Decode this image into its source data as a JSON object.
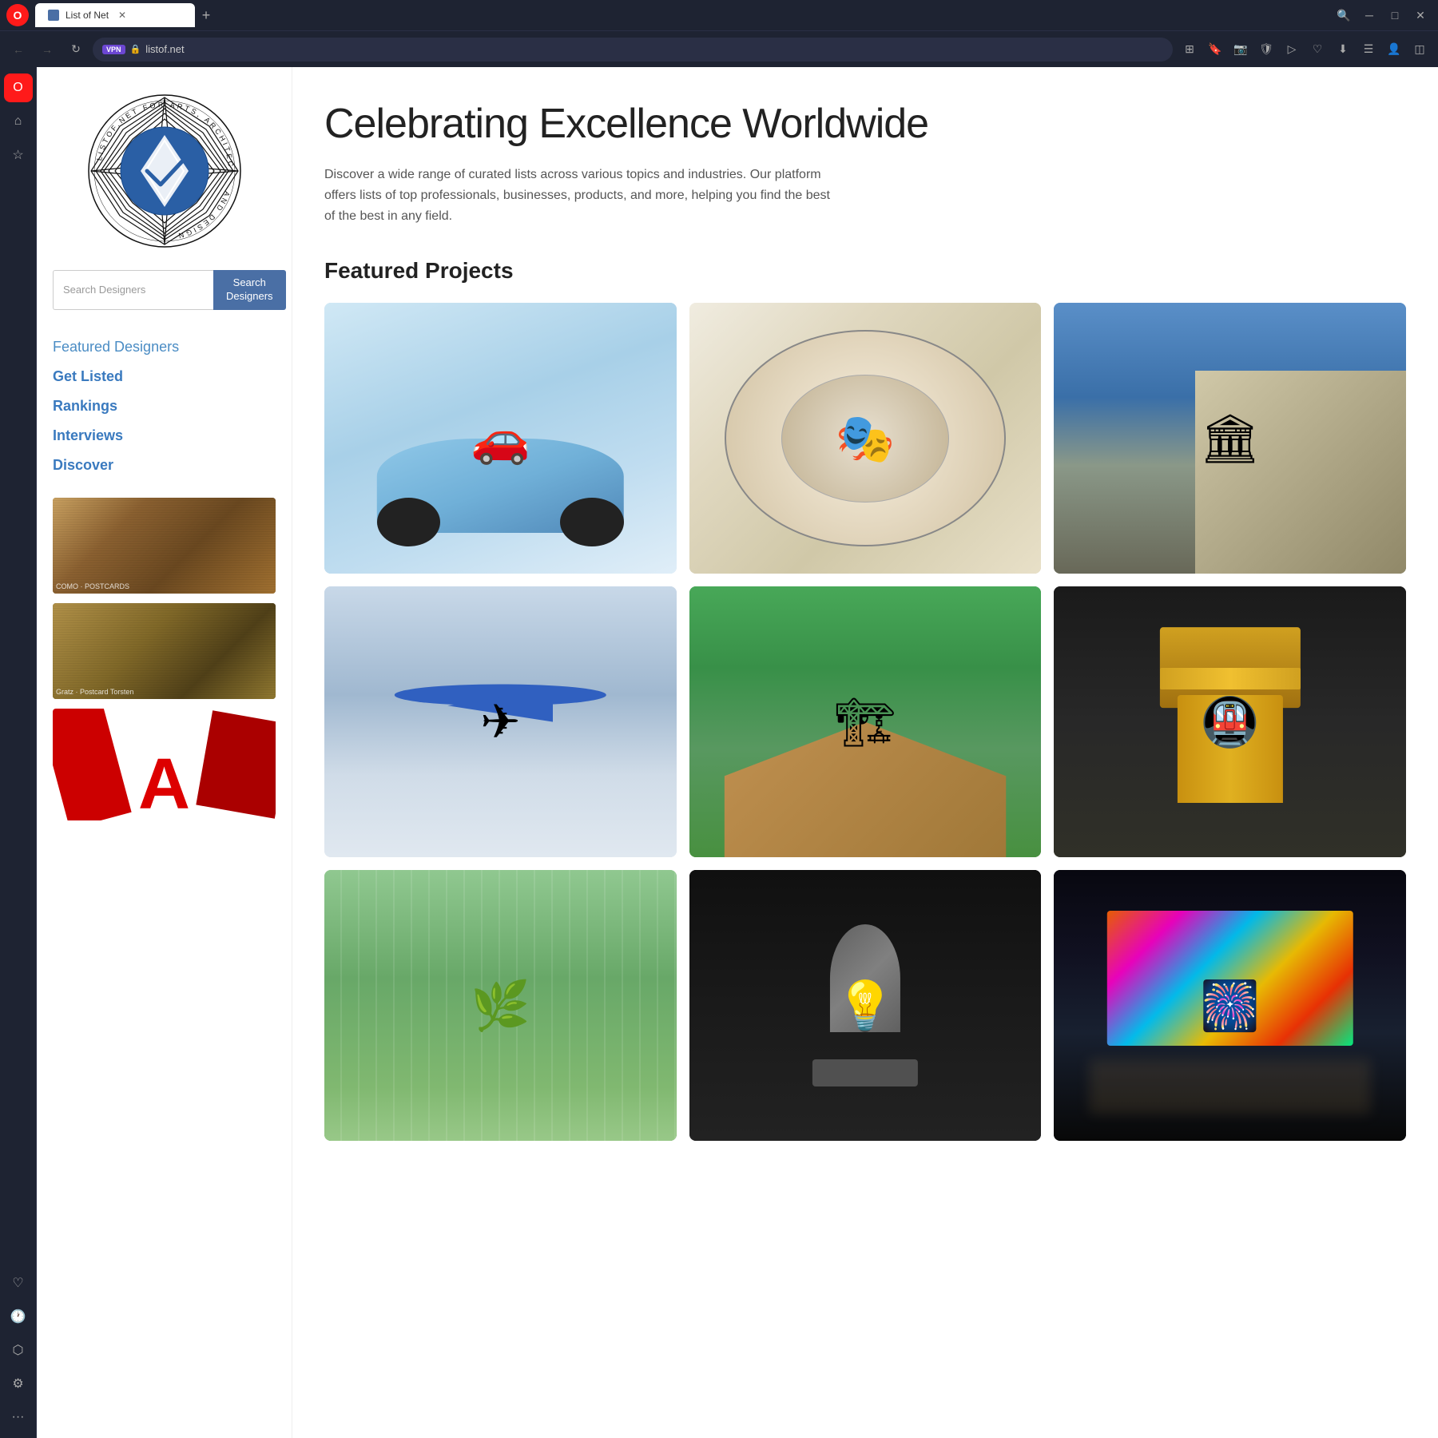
{
  "browser": {
    "tab_title": "List of Net",
    "tab_new_label": "+",
    "address": "listof.net",
    "vpn_label": "VPN",
    "search_icon_label": "🔍",
    "minimize_label": "─",
    "maximize_label": "□",
    "close_label": "✕"
  },
  "sidebar": {
    "icons": [
      {
        "name": "opera-home",
        "label": "O",
        "active": true
      },
      {
        "name": "home",
        "label": "⌂"
      },
      {
        "name": "star",
        "label": "☆"
      },
      {
        "name": "heart",
        "label": "♡"
      },
      {
        "name": "clock",
        "label": "🕐"
      },
      {
        "name": "cube",
        "label": "⬡"
      },
      {
        "name": "gear",
        "label": "⚙"
      }
    ],
    "more_label": "···"
  },
  "page": {
    "logo_alt": "LISTOF.NET FOR ARTS, ARCHITECTURE AND DESIGN",
    "hero_title": "Celebrating Excellence Worldwide",
    "hero_desc": "Discover a wide range of curated lists across various topics and industries. Our platform offers lists of top professionals, businesses, products, and more, helping you find the best of the best in any field.",
    "search_placeholder": "Search Designers",
    "search_btn_label": "Search\nDesigners",
    "nav": {
      "featured_designers": "Featured Designers",
      "get_listed": "Get Listed",
      "rankings": "Rankings",
      "interviews": "Interviews",
      "discover": "Discover"
    },
    "featured_projects_title": "Featured Projects",
    "projects": [
      {
        "id": "car",
        "type": "car",
        "alt": "Blue electric car"
      },
      {
        "id": "decor",
        "type": "decor",
        "alt": "Decorative interior design"
      },
      {
        "id": "building",
        "type": "building",
        "alt": "Modern architecture building"
      },
      {
        "id": "plane",
        "type": "plane",
        "alt": "Small blue aircraft in clouds"
      },
      {
        "id": "pavilion",
        "type": "pavilion",
        "alt": "Wooden pavilion architecture"
      },
      {
        "id": "tunnel",
        "type": "tunnel",
        "alt": "Underground tunnel with escalators"
      },
      {
        "id": "greenhouse",
        "type": "greenhouse",
        "alt": "Greenhouse interior"
      },
      {
        "id": "lamp",
        "type": "lamp",
        "alt": "Modern lamp on black background"
      },
      {
        "id": "billboard",
        "type": "billboard",
        "alt": "Colorful LED billboard at night"
      }
    ],
    "sidebar_images": [
      {
        "id": "img1",
        "caption": "COMO · POSTCARDS",
        "type": "sepia1"
      },
      {
        "id": "img2",
        "caption": "Gratz · Postcard Torsten",
        "type": "sepia2"
      },
      {
        "id": "img3",
        "caption": "",
        "type": "red_abstract"
      }
    ]
  }
}
